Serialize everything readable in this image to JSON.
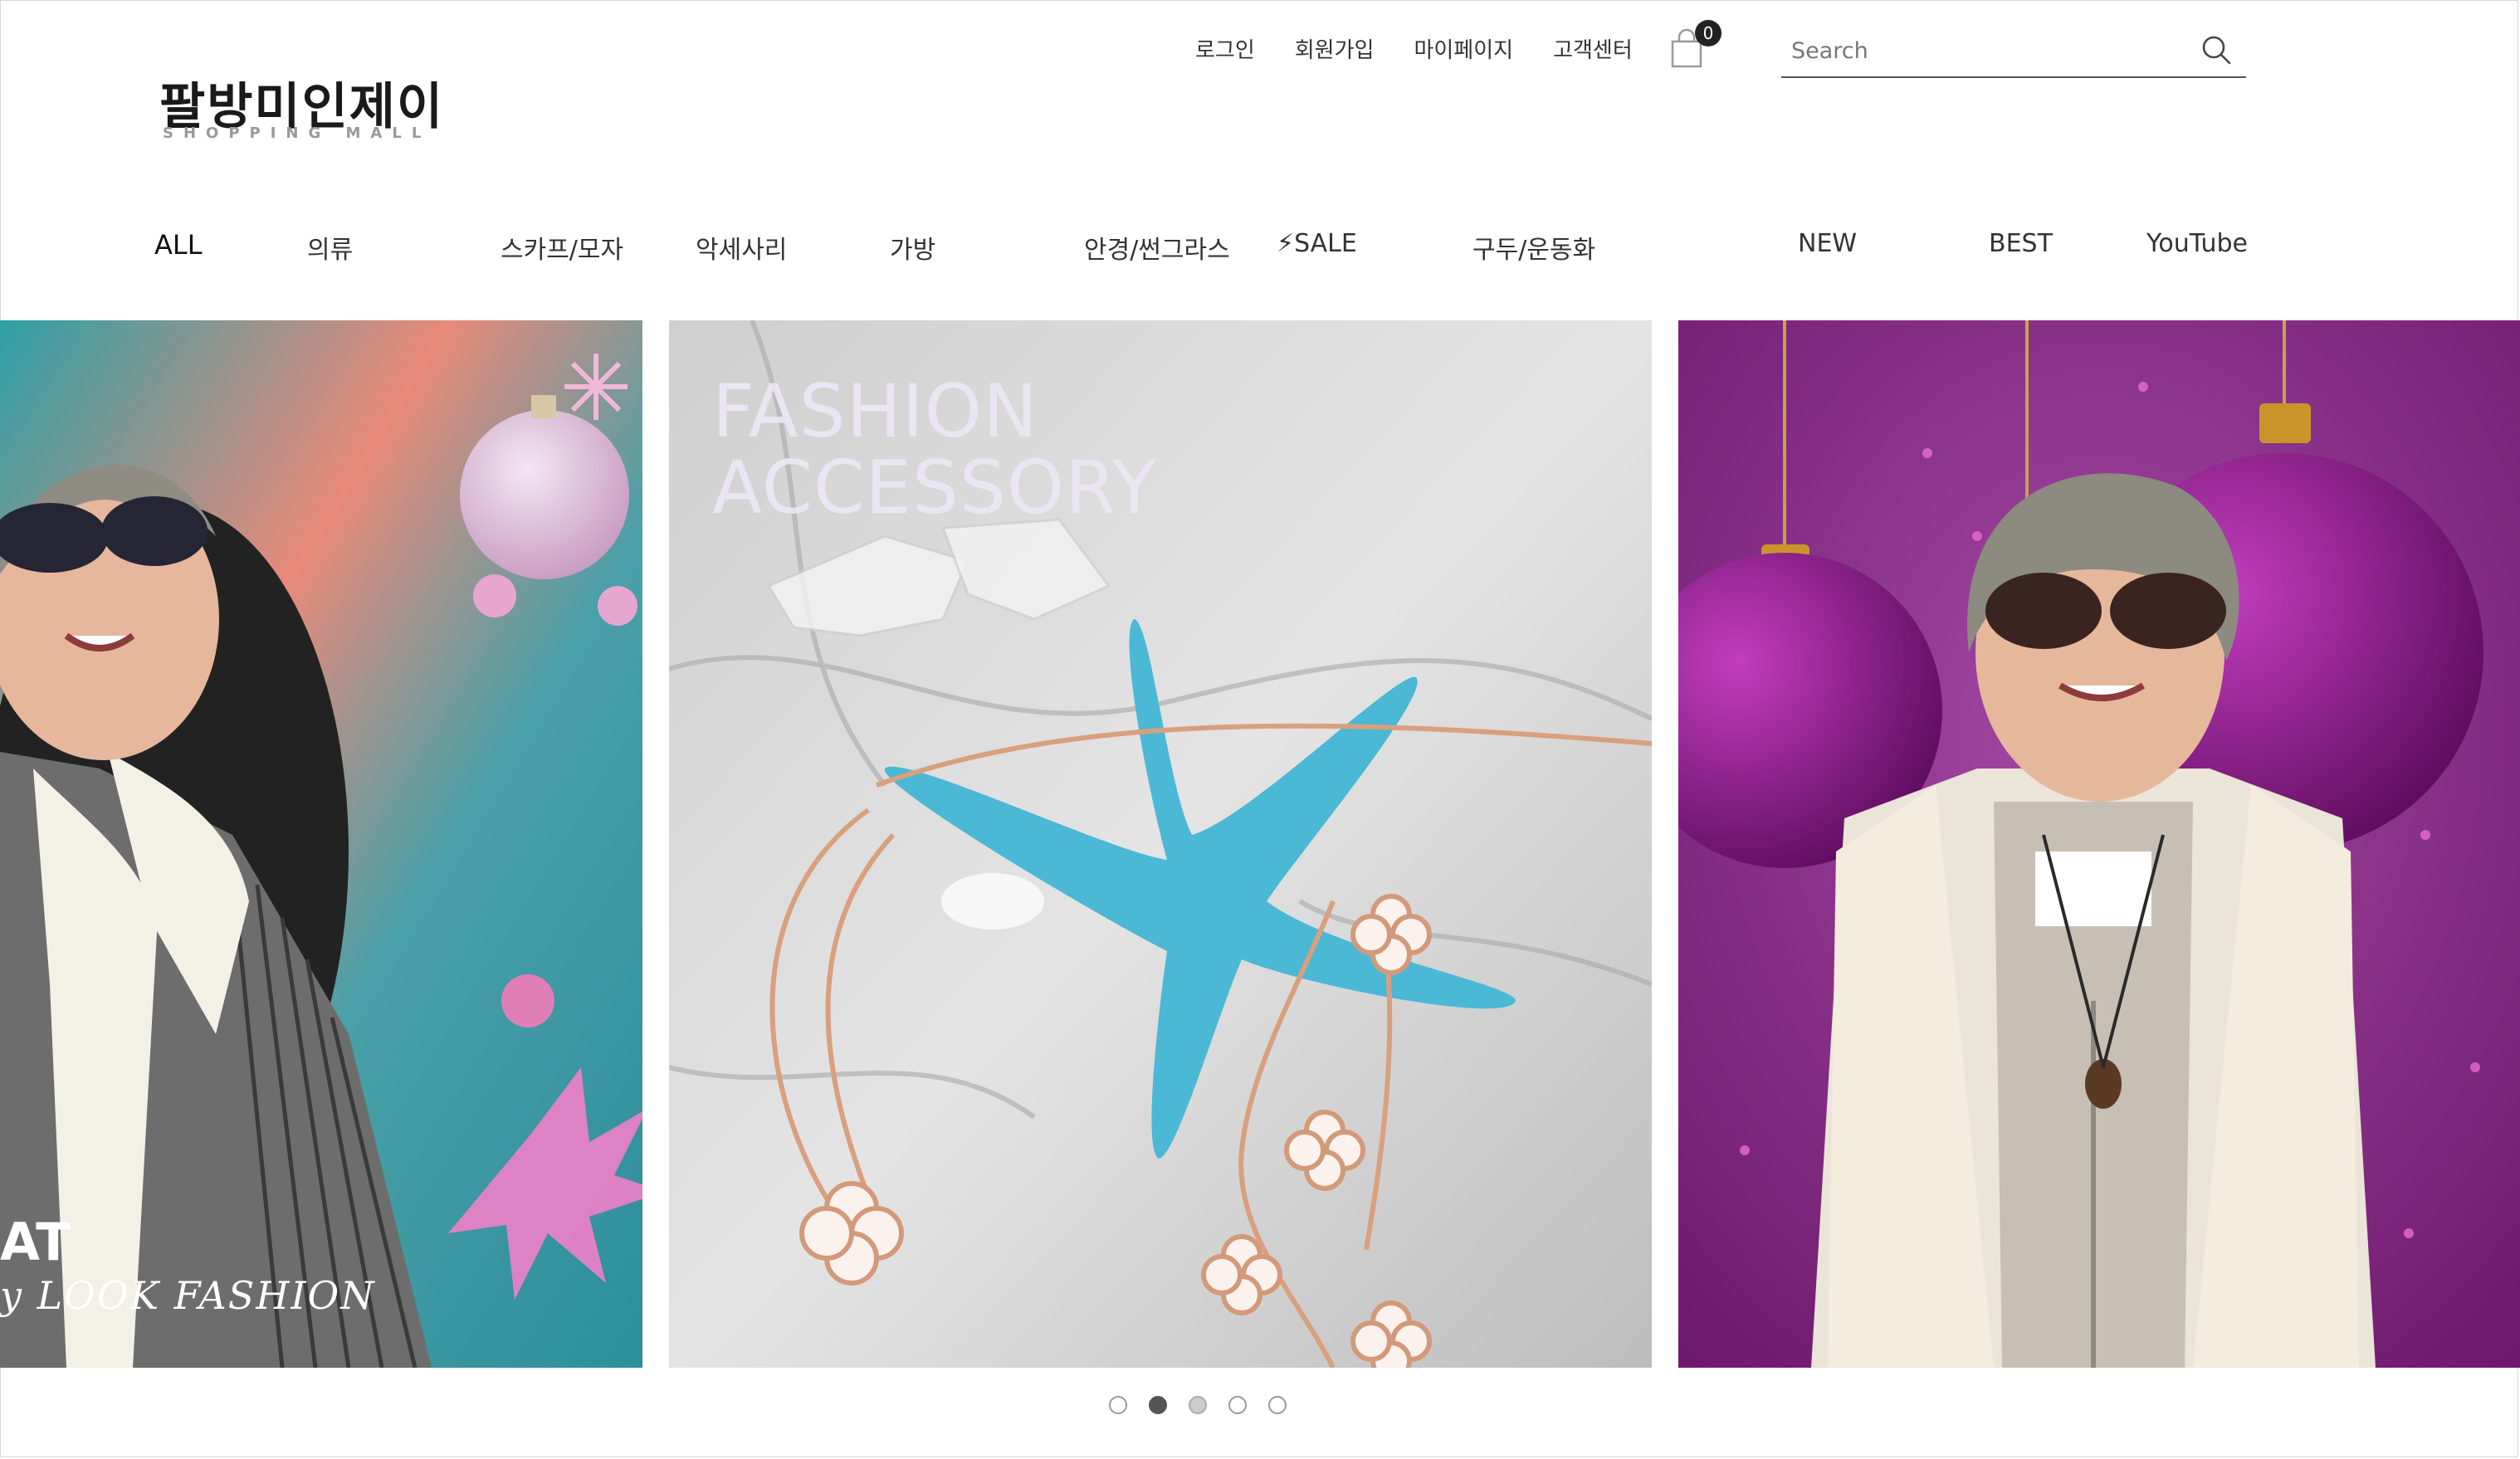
{
  "header": {
    "util_links": [
      "로그인",
      "회원가입",
      "마이페이지",
      "고객센터"
    ],
    "cart_count": "0",
    "search_placeholder": "Search"
  },
  "logo": {
    "name": "팔방미인제이",
    "tagline": "SHOPPING MALL"
  },
  "category_nav": {
    "items": [
      "ALL",
      "의류",
      "스카프/모자",
      "악세사리",
      "가방",
      "안경/썬그라스",
      "⚡SALE",
      "구두/운동화",
      "NEW",
      "BEST",
      "YouTube"
    ]
  },
  "banner": {
    "center_title_line1": "FASHION",
    "center_title_line2": "ACCESSORY",
    "left_caption_line1": "AT",
    "left_caption_line2": "y LOOK FASHION",
    "pager_total": 5,
    "pager_active_index": 1
  },
  "colors": {
    "slide_left_bg": "#4fa3a5",
    "slide_center_bg": "#d9d9d9",
    "slide_right_bg": "#7a1f7a",
    "starfish": "#4bb8d6",
    "necklace": "#d9a07e",
    "ornament_purple": "#8a1a8a"
  }
}
